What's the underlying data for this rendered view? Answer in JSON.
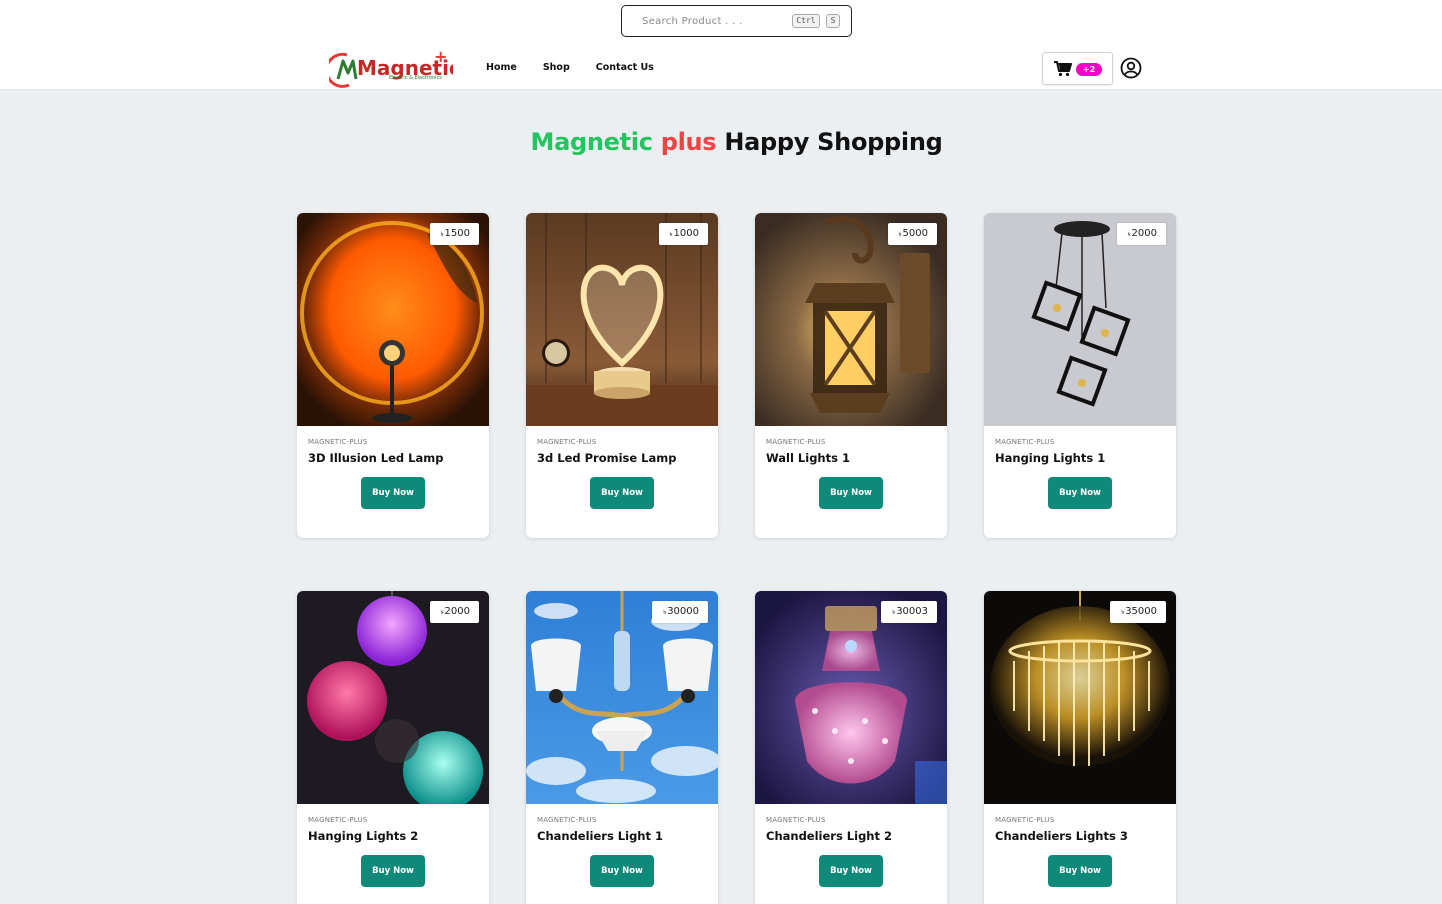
{
  "search": {
    "placeholder": "Search Product . . .",
    "key1": "Ctrl",
    "key2": "S"
  },
  "logo": {
    "text": "Magnetic",
    "sub": "Electric & Electronics"
  },
  "nav": [
    {
      "label": "Home"
    },
    {
      "label": "Shop"
    },
    {
      "label": "Contact Us"
    }
  ],
  "cart": {
    "badge": "+2"
  },
  "hero": {
    "part1": "Magnetic",
    "part2": "plus",
    "part3": "Happy Shopping"
  },
  "currency": "৳",
  "products": [
    {
      "brand": "MAGNETIC-PLUS",
      "name": "3D Illusion Led Lamp",
      "price": "1500",
      "buy": "Buy Now"
    },
    {
      "brand": "MAGNETIC-PLUS",
      "name": "3d Led Promise Lamp",
      "price": "1000",
      "buy": "Buy Now"
    },
    {
      "brand": "MAGNETIC-PLUS",
      "name": "Wall Lights 1",
      "price": "5000",
      "buy": "Buy Now"
    },
    {
      "brand": "MAGNETIC-PLUS",
      "name": "Hanging Lights 1",
      "price": "2000",
      "buy": "Buy Now"
    },
    {
      "brand": "MAGNETIC-PLUS",
      "name": "Hanging Lights 2",
      "price": "2000",
      "buy": "Buy Now"
    },
    {
      "brand": "MAGNETIC-PLUS",
      "name": "Chandeliers Light 1",
      "price": "30000",
      "buy": "Buy Now"
    },
    {
      "brand": "MAGNETIC-PLUS",
      "name": "Chandeliers Light 2",
      "price": "30003",
      "buy": "Buy Now"
    },
    {
      "brand": "MAGNETIC-PLUS",
      "name": "Chandeliers Lights 3",
      "price": "35000",
      "buy": "Buy Now"
    }
  ],
  "colors": {
    "accent": "#0f8a7a",
    "badge": "#f403c6",
    "green": "#22c55e",
    "red": "#ef4444"
  }
}
